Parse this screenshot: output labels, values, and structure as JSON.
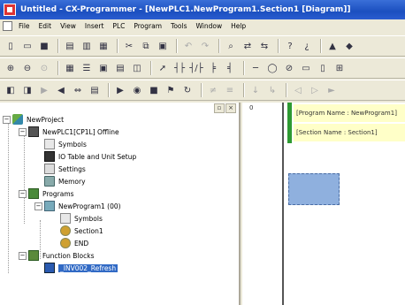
{
  "window": {
    "title": "Untitled - CX-Programmer - [NewPLC1.NewProgram1.Section1 [Diagram]]"
  },
  "menubar": {
    "items": [
      "File",
      "Edit",
      "View",
      "Insert",
      "PLC",
      "Program",
      "Tools",
      "Window",
      "Help"
    ]
  },
  "toolbars": [
    {
      "icons": [
        "new-icon",
        "open-icon",
        "save-icon",
        "separator",
        "print-preview-icon",
        "print-icon",
        "preview-icon",
        "separator",
        "cut-icon",
        "copy-icon",
        "paste-icon",
        "separator",
        "undo-icon",
        "redo-icon",
        "separator",
        "find-icon",
        "replace-icon",
        "cross-ref-icon",
        "separator",
        "help-icon",
        "context-help-icon",
        "separator",
        "warning-icon",
        "bell-icon"
      ]
    },
    {
      "icons": [
        "zoom-in-icon",
        "zoom-out-icon",
        "zoom-fit-icon",
        "separator",
        "grid-icon",
        "list-icon",
        "monitor-icon",
        "table-icon",
        "watch-icon",
        "separator",
        "pointer-icon",
        "contact-no-icon",
        "contact-nc-icon",
        "contact-or-icon",
        "contact-ornc-icon",
        "separator",
        "line-icon",
        "coil-icon",
        "coil-nc-icon",
        "instruction-icon",
        "counter-icon",
        "timer-icon"
      ]
    },
    {
      "icons": [
        "online-icon",
        "offline-icon",
        "transfer-to-icon",
        "transfer-from-icon",
        "compare-icon",
        "mode-icon",
        "separator",
        "run-icon",
        "monitor-mode-icon",
        "program-mode-icon",
        "force-icon",
        "cycle-icon",
        "separator",
        "diff-icon",
        "set-icon",
        "separator",
        "step-icon",
        "step-over-icon",
        "separator",
        "back-icon",
        "forward-icon",
        "play-icon"
      ]
    }
  ],
  "tree": [
    {
      "label": "NewProject",
      "icon": "project-icon",
      "exp": "−"
    },
    {
      "label": "NewPLC1[CP1L] Offline",
      "icon": "plc-icon",
      "exp": "−"
    },
    {
      "label": "Symbols",
      "icon": "symbols-icon",
      "exp": ""
    },
    {
      "label": "IO Table and Unit Setup",
      "icon": "io-table-icon",
      "exp": ""
    },
    {
      "label": "Settings",
      "icon": "settings-icon",
      "exp": ""
    },
    {
      "label": "Memory",
      "icon": "memory-icon",
      "exp": ""
    },
    {
      "label": "Programs",
      "icon": "programs-icon",
      "exp": "−"
    },
    {
      "label": "NewProgram1 (00)",
      "icon": "program-icon",
      "exp": "−"
    },
    {
      "label": "Symbols",
      "icon": "symbols-icon",
      "exp": ""
    },
    {
      "label": "Section1",
      "icon": "section-icon",
      "exp": ""
    },
    {
      "label": "END",
      "icon": "end-section-icon",
      "exp": ""
    },
    {
      "label": "Function Blocks",
      "icon": "function-blocks-icon",
      "exp": "−"
    },
    {
      "label": "_INV002_Refresh",
      "icon": "function-block-icon",
      "exp": ""
    }
  ],
  "ladder": {
    "row_number": "0",
    "program_comment": "[Program Name : NewProgram1]",
    "section_comment": "[Section Name : Section1]"
  },
  "colors": {
    "titlebar": "#1b4fbf",
    "rung_marker": "#2e9a32",
    "comment_bg": "#ffffc8",
    "cursor": "#8fb0de",
    "selection": "#316ac5"
  }
}
